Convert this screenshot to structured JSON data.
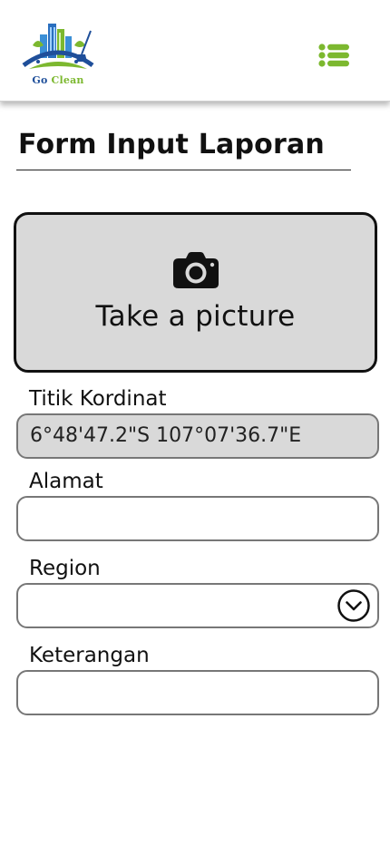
{
  "header": {
    "logo_go": "Go",
    "logo_clean": "Clean",
    "menu_icon": "list-menu-icon",
    "accent_color": "#7cb82f"
  },
  "page": {
    "title": "Form Input Laporan"
  },
  "camera": {
    "icon": "camera-icon",
    "label": "Take a picture"
  },
  "form": {
    "coordinates": {
      "label": "Titik Kordinat",
      "value": "6°48'47.2\"S 107°07'36.7\"E"
    },
    "address": {
      "label": "Alamat",
      "value": ""
    },
    "region": {
      "label": "Region",
      "value": "",
      "icon": "chevron-down-circle-icon"
    },
    "notes": {
      "label": "Keterangan",
      "value": ""
    }
  }
}
